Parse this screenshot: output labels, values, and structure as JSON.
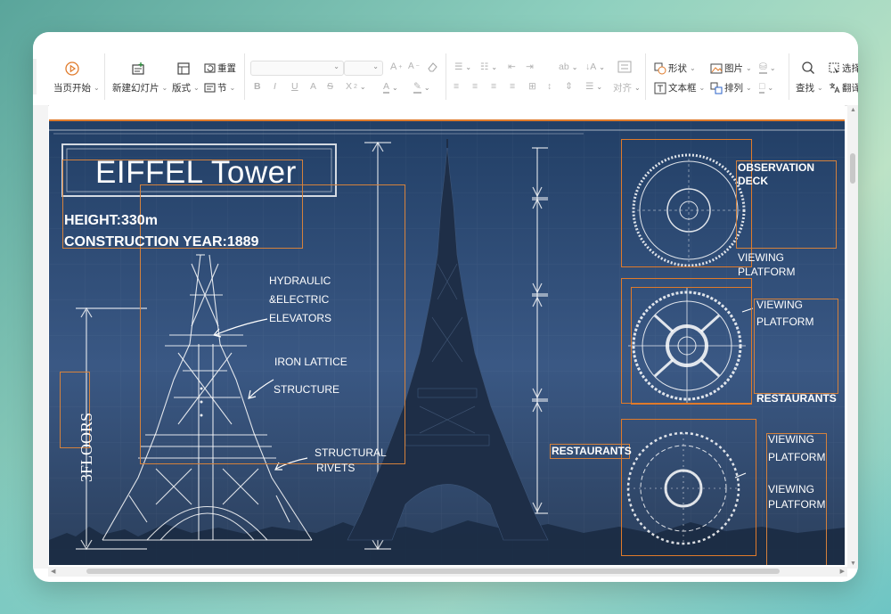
{
  "ribbon": {
    "slideshow_label": "当页开始",
    "new_slide_label": "新建幻灯片",
    "layout_label": "版式",
    "reset_label": "重置",
    "section_label": "节",
    "align_label": "对齐",
    "shape_label": "形状",
    "picture_label": "图片",
    "textbox_label": "文本框",
    "arrange_label": "排列",
    "find_label": "查找",
    "select_label": "选择",
    "translate_label": "翻译"
  },
  "slide": {
    "title": "EIFFEL Tower",
    "height_text": "HEIGHT:330m",
    "year_text": "CONSTRUCTION YEAR:1889",
    "floors_text": "3FLOORS",
    "hydraulic_1": "HYDRAULIC",
    "hydraulic_2": "&ELECTRIC",
    "hydraulic_3": "ELEVATORS",
    "iron_1": "IRON  LATTICE",
    "iron_2": "STRUCTURE",
    "rivets_1": "STRUCTURAL",
    "rivets_2": "RIVETS",
    "observation_1": "OBSERVATION",
    "observation_2": "DECK",
    "viewing_1a": "VIEWING",
    "viewing_1b": "PLATFORM",
    "viewing_2a": "VIEWING",
    "viewing_2b": "PLATFORM",
    "restaurants_1": "RESTAURANTS",
    "restaurants_2": "RESTAURANTS",
    "viewing_3a": "VIEWING",
    "viewing_3b": "PLATFORM",
    "viewing_4a": "VIEWING",
    "viewing_4b": "PLATFORM"
  },
  "colors": {
    "accent_orange": "#e07a2a",
    "slide_bg": "#2a4670"
  }
}
